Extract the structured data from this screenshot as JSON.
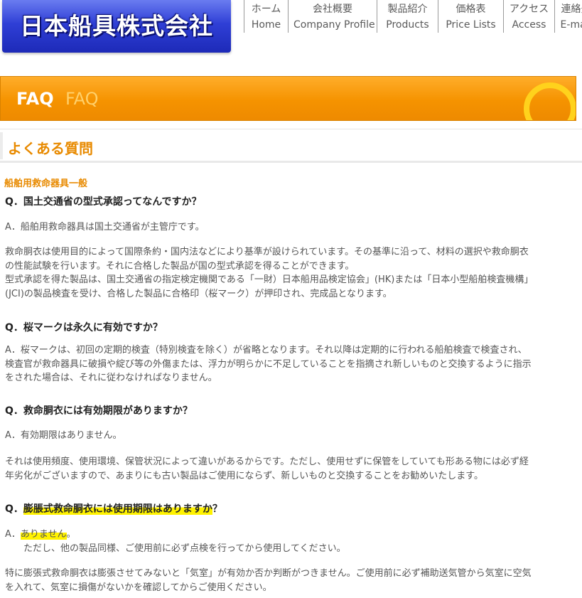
{
  "header": {
    "logo_text": "日本船具株式会社",
    "nav": [
      {
        "jp": "ホーム",
        "en": "Home"
      },
      {
        "jp": "会社概要",
        "en": "Company Profile"
      },
      {
        "jp": "製品紹介",
        "en": "Products"
      },
      {
        "jp": "価格表",
        "en": "Price Lists"
      },
      {
        "jp": "アクセス",
        "en": "Access"
      },
      {
        "jp": "連絡先",
        "en": "E-mail"
      }
    ]
  },
  "banner": {
    "title": "FAQ",
    "subtitle": "FAQ"
  },
  "section": {
    "title": "よくある質問"
  },
  "faq": {
    "category": "船舶用救命器具一般",
    "items": [
      {
        "q": "Q．国土交通省の型式承認ってなんですか？",
        "a": "A．船舶用救命器具は国土交通省が主管庁です。",
        "p1": "救命胴衣は使用目的によって国際条約・国内法などにより基準が設けられています。その基準に沿って、材料の選択や救命胴衣",
        "p2": "の性能試験を行います。それに合格した製品が国の型式承認を得ることができます。",
        "p3": "型式承認を得た製品は、国土交通省の指定検定機関である「一財）日本船用品検定協会」(HK)または「日本小型船舶検査機構」",
        "p4": "(JCI)の製品検査を受け、合格した製品に合格印（桜マーク）が押印され、完成品となります。"
      },
      {
        "q": "Q．桜マークは永久に有効ですか？",
        "a1": "A．桜マークは、初回の定期的検査（特別検査を除く）が省略となります。それ以降は定期的に行われる船舶検査で検査され、",
        "a2": "検査官が救命器具に破損や綻び等の外傷または、浮力が明らかに不足していることを指摘され新しいものと交換するように指示",
        "a3": "をされた場合は、それに従わなければなりません。"
      },
      {
        "q": "Q．救命胴衣には有効期限がありますか？",
        "a": "A．有効期限はありません。",
        "p1": "それは使用頻度、使用環境、保管状況によって違いがあるからです。ただし、使用せずに保管をしていても形ある物には必ず経",
        "p2": "年劣化がございますので、あまりにも古い製品はご使用にならず、新しいものと交換することをお勧めいたします。"
      },
      {
        "q_prefix": "Q．",
        "q_highlight": "膨脹式救命胴衣には使用期限はありますか",
        "q_suffix": "？",
        "a_prefix": "A．",
        "a_highlight": "ありません",
        "a_suffix": "。",
        "a_line2": "ただし、他の製品同様、ご使用前に必ず点検を行ってから使用してください。",
        "p1": "特に膨張式救命胴衣は膨張させてみないと「気室」が有効か否か判断がつきません。ご使用前に必ず補助送気管から気室に空気",
        "p2": "を入れて、気室に損傷がないかを確認してからご使用ください。"
      }
    ]
  },
  "colors": {
    "accent_orange": "#f59300",
    "logo_blue": "#2f3fd6",
    "highlight_yellow": "#fff200"
  }
}
